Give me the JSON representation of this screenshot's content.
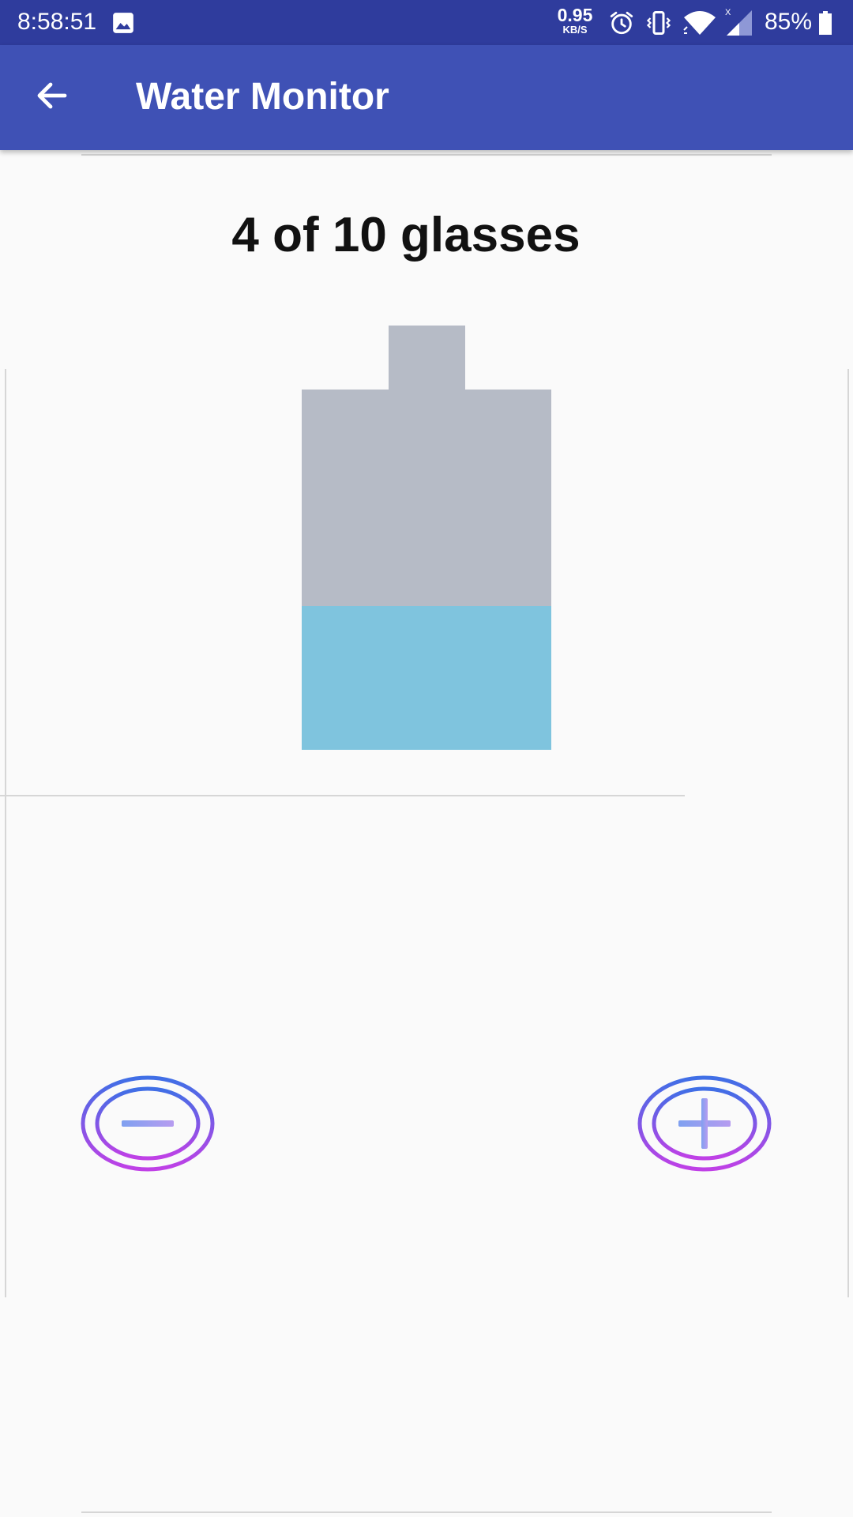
{
  "status_bar": {
    "time": "8:58:51",
    "net_speed_value": "0.95",
    "net_speed_unit": "KB/S",
    "battery_percent": "85%",
    "battery_level": 0.85,
    "icons": [
      "image-icon",
      "alarm-icon",
      "vibrate-icon",
      "wifi-icon",
      "signal-icon",
      "battery-icon"
    ]
  },
  "app_bar": {
    "title": "Water Monitor",
    "back_icon": "arrow-left-icon"
  },
  "main": {
    "count_text": "4 of 10 glasses",
    "glasses_consumed": 4,
    "glasses_goal": 10,
    "bottle": {
      "fill_fraction": 0.4,
      "empty_color": "#b6bbc6",
      "water_color": "#7fc4de"
    },
    "buttons": {
      "decrease_icon": "minus-circle-icon",
      "increase_icon": "plus-circle-icon"
    }
  },
  "colors": {
    "status_bar": "#2f3c9d",
    "app_bar": "#3f51b5",
    "background": "#fafafa",
    "ring_gradient_start": "#3f6fe6",
    "ring_gradient_end": "#c040e6"
  }
}
